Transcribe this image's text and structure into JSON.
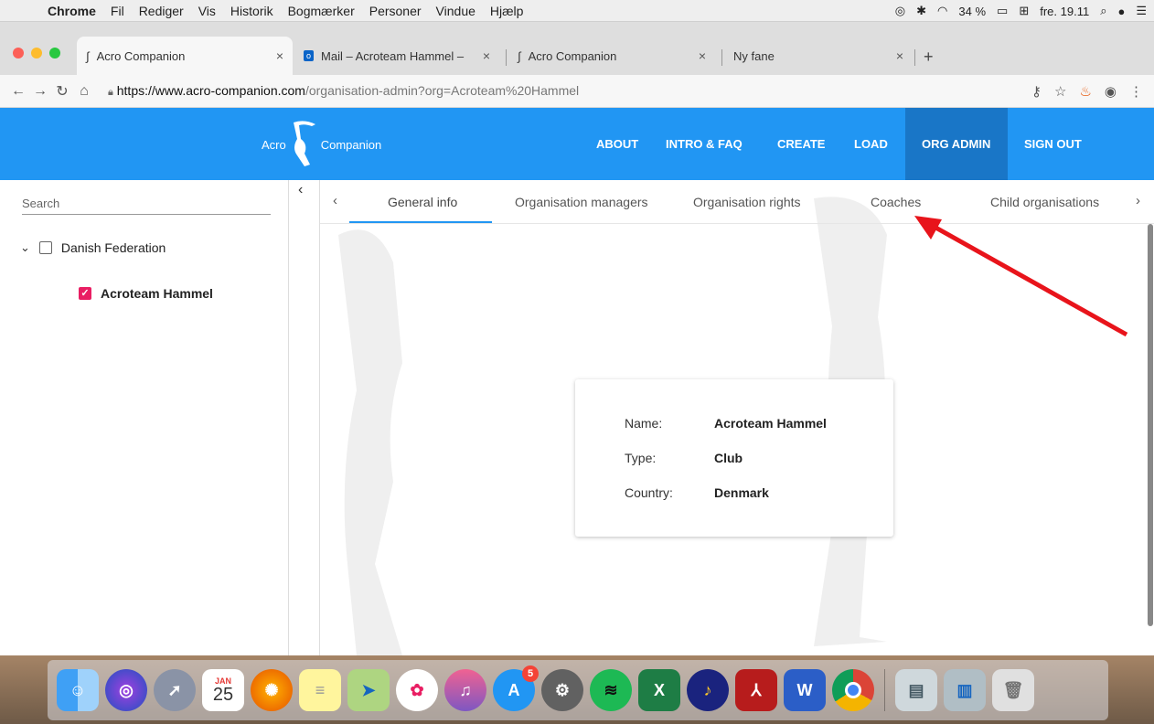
{
  "menubar": {
    "items": [
      "Chrome",
      "Fil",
      "Rediger",
      "Vis",
      "Historik",
      "Bogmærker",
      "Personer",
      "Vindue",
      "Hjælp"
    ],
    "battery": "34 %",
    "datetime": "fre. 19.11"
  },
  "browser": {
    "tabs": [
      {
        "title": "Acro Companion",
        "close": "×"
      },
      {
        "title": "Mail – Acroteam Hammel – Out",
        "close": "×"
      },
      {
        "title": "Acro Companion",
        "close": "×"
      },
      {
        "title": "Ny fane",
        "close": "×"
      }
    ],
    "new_tab": "+",
    "url_host": "https://www.acro-companion.com",
    "url_path": "/organisation-admin?org=Acroteam%20Hammel"
  },
  "header": {
    "logo_left": "Acro",
    "logo_right": "Companion",
    "nav": [
      "ABOUT",
      "INTRO & FAQ",
      "CREATE",
      "LOAD",
      "ORG ADMIN",
      "SIGN OUT"
    ],
    "accent_color": "#2196f3",
    "active_color": "#1976c7"
  },
  "sidebar": {
    "search_placeholder": "Search",
    "tree": [
      {
        "label": "Danish Federation",
        "checked": false
      },
      {
        "label": "Acroteam Hammel",
        "checked": true
      }
    ],
    "check_color": "#e91e63"
  },
  "main": {
    "tabs": [
      "General info",
      "Organisation managers",
      "Organisation rights",
      "Coaches",
      "Child organisations"
    ],
    "active_tab": "General info",
    "info": {
      "name_label": "Name:",
      "name_value": "Acroteam Hammel",
      "type_label": "Type:",
      "type_value": "Club",
      "country_label": "Country:",
      "country_value": "Denmark"
    }
  },
  "dock": {
    "calendar_month": "JAN",
    "calendar_day": "25",
    "app_store_badge": "5",
    "excel_label": "X",
    "word_label": "W"
  },
  "annotation": {
    "color": "#e8141b"
  }
}
